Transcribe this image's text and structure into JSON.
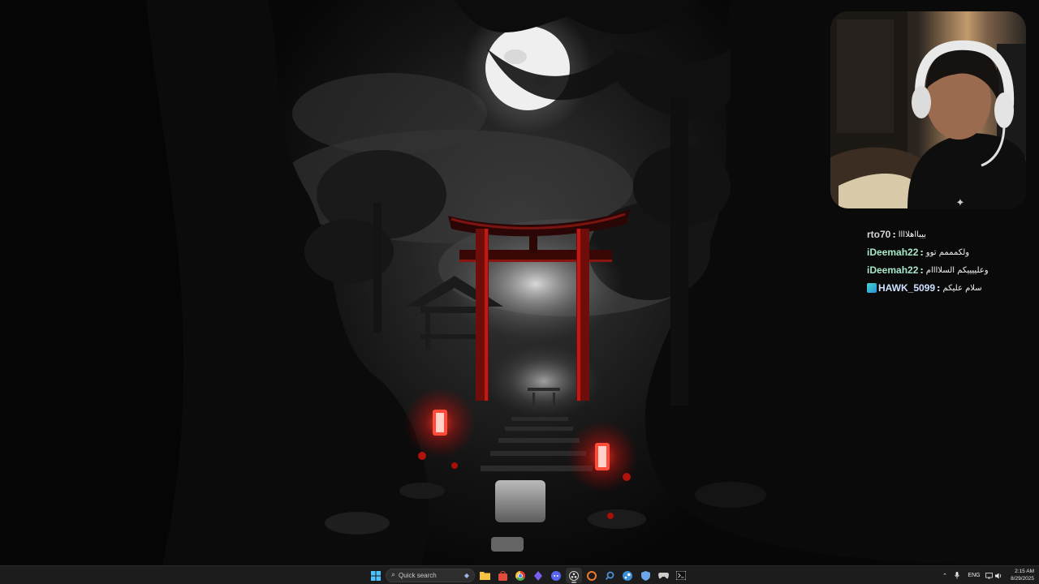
{
  "colors": {
    "accent_red": "#e0201a",
    "moon": "#f2f2f2",
    "taskbar_bg": "#1c1c1c"
  },
  "chat": {
    "messages": [
      {
        "user": "rto70",
        "user_color": "#d6d6d6",
        "text": "بيبااهلاااا",
        "badge": false
      },
      {
        "user": "iDeemah22",
        "user_color": "#a7e9c8",
        "text": "ولكمممم توو",
        "badge": false
      },
      {
        "user": "iDeemah22",
        "user_color": "#a7e9c8",
        "text": "وعلييييكم السلاااام",
        "badge": false
      },
      {
        "user": "HAWK_5099",
        "user_color": "#cfe1ff",
        "text": "سلام عليكم",
        "badge": true
      }
    ]
  },
  "taskbar": {
    "search_placeholder": "Quick search",
    "apps": [
      {
        "name": "start-icon",
        "color": "#4cc2ff"
      },
      {
        "name": "file-explorer-icon",
        "color": "#f5c242"
      },
      {
        "name": "store-icon",
        "color": "#e34b3c"
      },
      {
        "name": "chrome-icon",
        "color": "#3fae49"
      },
      {
        "name": "app-purple-icon",
        "color": "#7b5cf0"
      },
      {
        "name": "discord-icon",
        "color": "#5865f2"
      },
      {
        "name": "obs-icon",
        "color": "#d8d8d8"
      },
      {
        "name": "app-orange-icon",
        "color": "#f07a2a"
      },
      {
        "name": "search-app-icon",
        "color": "#4a90d9"
      },
      {
        "name": "steam-icon",
        "color": "#3d8fd6"
      },
      {
        "name": "shield-app-icon",
        "color": "#6aa6e8"
      },
      {
        "name": "controller-icon",
        "color": "#cccccc"
      },
      {
        "name": "terminal-icon",
        "color": "#cccccc"
      }
    ],
    "tray": {
      "language": "ENG"
    },
    "clock": {
      "time": "2:15 AM",
      "date": "8/29/2025"
    }
  }
}
